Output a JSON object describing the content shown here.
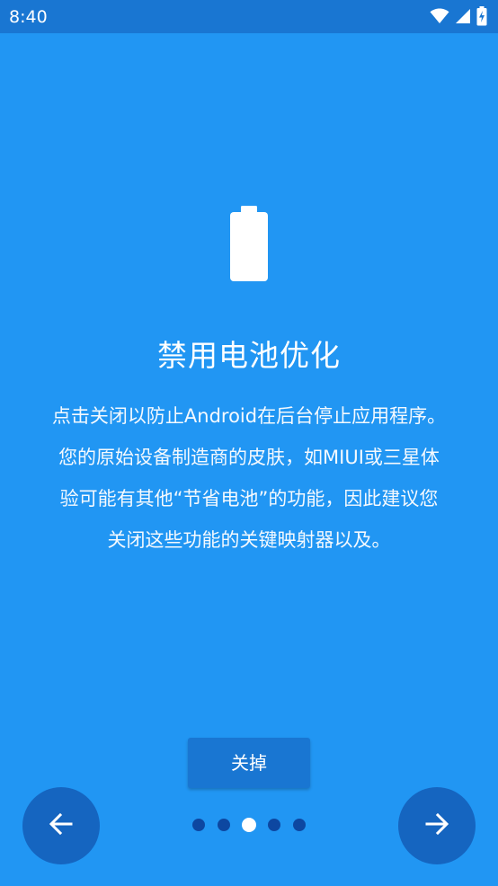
{
  "status_bar": {
    "time": "8:40",
    "icons": [
      "wifi-icon",
      "cell-signal-icon",
      "battery-charging-icon"
    ]
  },
  "slide": {
    "icon": "battery-icon",
    "title": "禁用电池优化",
    "body_lines": [
      "点击关闭以防止Android在后台停止应用程序。",
      "您的原始设备制造商的皮肤，如MIUI或三星体",
      "验可能有其他“节省电池”的功能，因此建议您",
      "关闭这些功能的关键映射器以及。"
    ],
    "action_label": "关掉"
  },
  "navigation": {
    "back_icon": "arrow-left-icon",
    "next_icon": "arrow-right-icon",
    "page_count": 5,
    "current_page": 3
  },
  "colors": {
    "background": "#2196F3",
    "status_bar": "#1976D2",
    "button": "#1976D2",
    "nav_button": "#1565C0",
    "dot_inactive": "#0D47A1",
    "dot_active": "#FFFFFF"
  }
}
